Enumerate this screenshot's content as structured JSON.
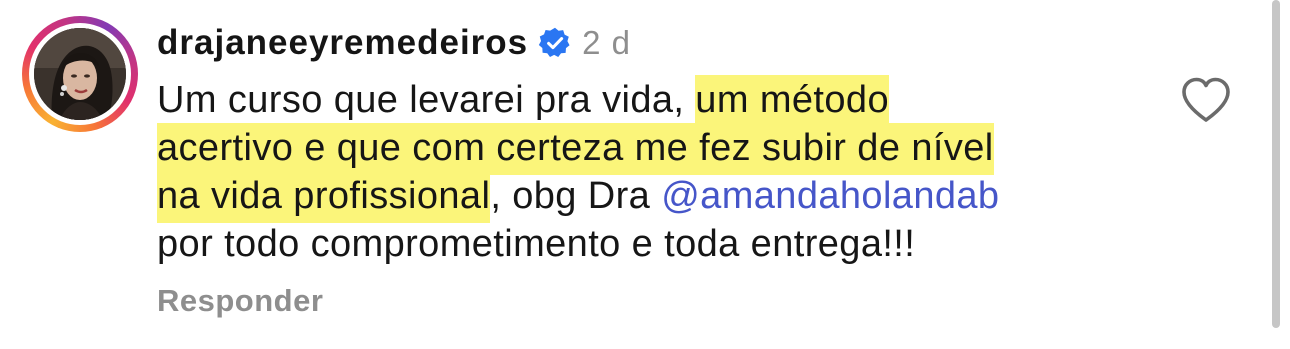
{
  "comment": {
    "username": "drajaneeyremedeiros",
    "verified": true,
    "time_ago": "2 d",
    "text": {
      "line1_plain": "Um curso que levarei pra vida, ",
      "line1_highlight": "um método",
      "line2_highlight": "acertivo e que com certeza me fez subir de nível",
      "line3_highlight": "na vida profissional",
      "line3_plain": ", obg Dra ",
      "mention": "@amandaholandab",
      "line4_plain": "por todo comprometimento e toda entrega!!!"
    },
    "reply_label": "Responder"
  },
  "colors": {
    "highlight": "#fbf57a",
    "mention": "#4656c9",
    "verified_badge": "#2a76f2",
    "muted_text": "#8e8e8e"
  },
  "icons": {
    "verified": "verified-badge-icon",
    "like": "heart-outline-icon"
  }
}
